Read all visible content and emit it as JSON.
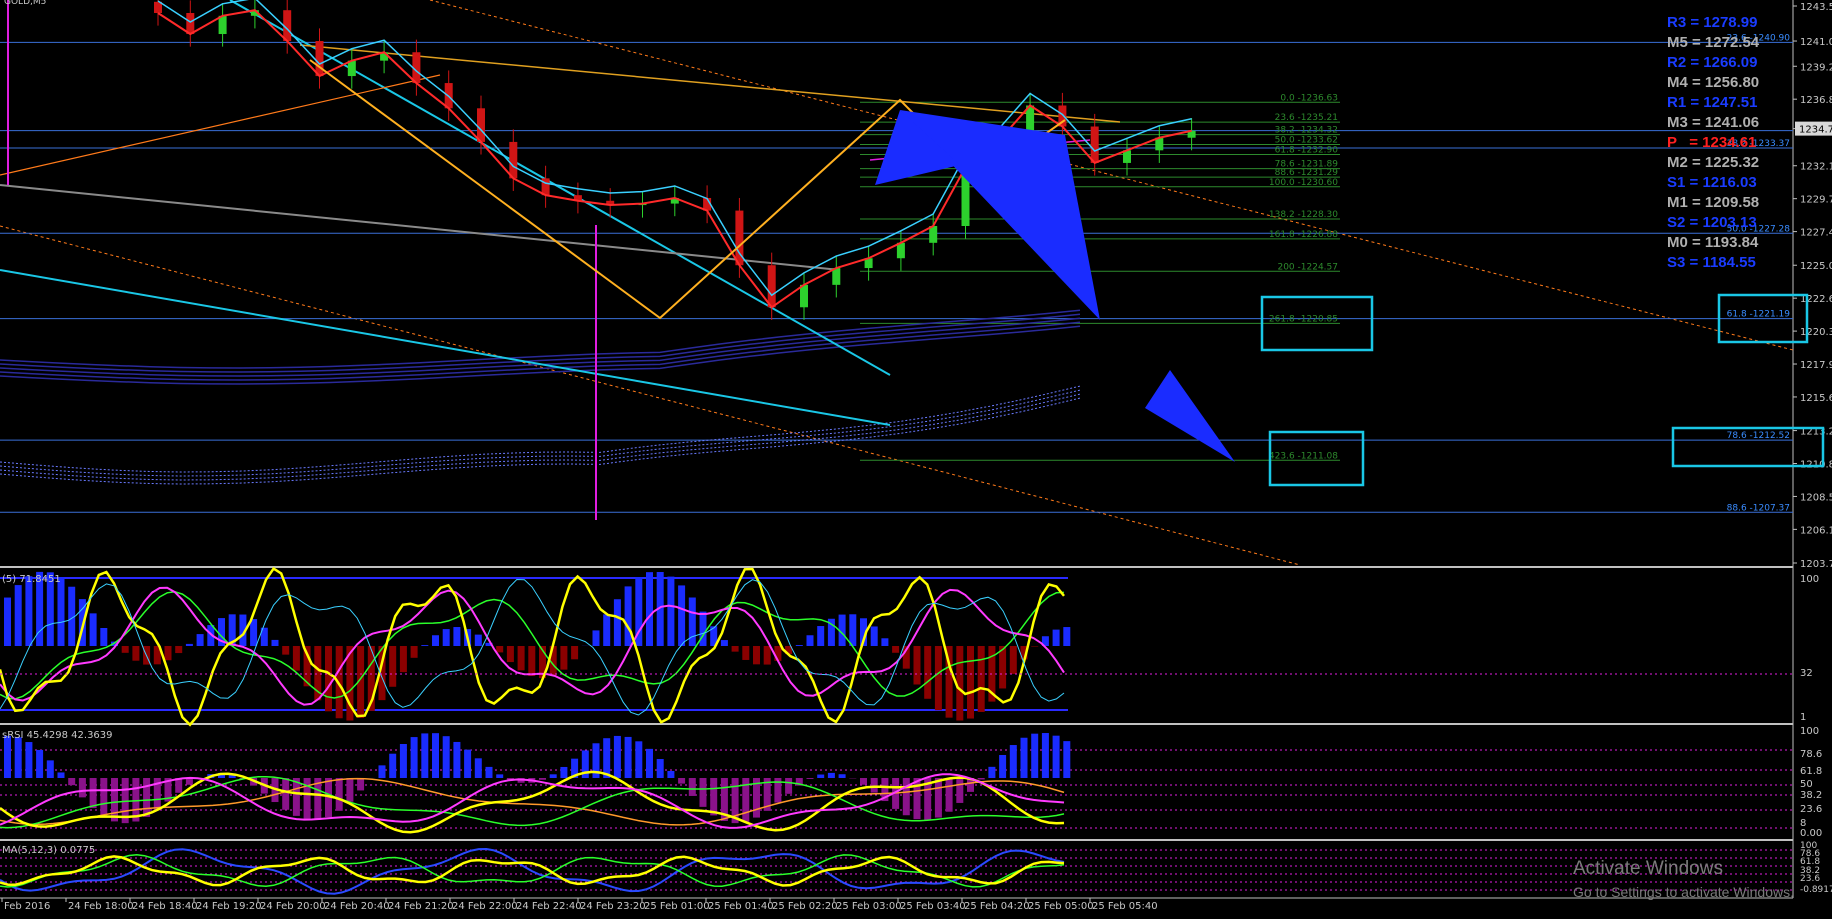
{
  "symbol": "GOLD,M5",
  "colors": {
    "background": "#000000",
    "axis_text": "#c8c8c8",
    "grid_blue": "#3a6fd8",
    "pivot_blue": "#1a3cff",
    "pivot_gray": "#b0b0b0",
    "pivot_red": "#ff2020",
    "fib_green": "#2d8a2d",
    "cyan": "#1ac7e6",
    "orange": "#ff7a1a",
    "magenta": "#e01ee0",
    "yellow": "#ffff00",
    "bull": "#2dd12d",
    "bear": "#d01515",
    "hist_blue": "#1a2cff",
    "hist_dark_red": "#8b0000",
    "hist_purple": "#8a128a"
  },
  "pivots": [
    {
      "label": "R3 = 1278.99",
      "kind": "blue"
    },
    {
      "label": "M5 = 1272.54",
      "kind": "gray"
    },
    {
      "label": "R2 = 1266.09",
      "kind": "blue"
    },
    {
      "label": "M4 = 1256.80",
      "kind": "gray"
    },
    {
      "label": "R1 = 1247.51",
      "kind": "blue"
    },
    {
      "label": "M3 = 1241.06",
      "kind": "gray"
    },
    {
      "label": "P   = 1234.61",
      "kind": "red"
    },
    {
      "label": "M2 = 1225.32",
      "kind": "gray"
    },
    {
      "label": "S1 = 1216.03",
      "kind": "blue"
    },
    {
      "label": "M1 = 1209.58",
      "kind": "gray"
    },
    {
      "label": "S2 = 1203.13",
      "kind": "blue"
    },
    {
      "label": "M0 = 1193.84",
      "kind": "gray"
    },
    {
      "label": "S3 = 1184.55",
      "kind": "blue"
    }
  ],
  "fib_labels_left": [
    {
      "text": "0.0 -1236.63",
      "y": 1236.63
    },
    {
      "text": "23.6 -1235.21",
      "y": 1235.21
    },
    {
      "text": "38.2 -1234.32",
      "y": 1234.32
    },
    {
      "text": "50.0 -1233.62",
      "y": 1233.62
    },
    {
      "text": "61.8 -1232.90",
      "y": 1232.9
    },
    {
      "text": "78.6 -1231.89",
      "y": 1231.89
    },
    {
      "text": "88.6 -1231.29",
      "y": 1231.29
    },
    {
      "text": "100.0 -1230.60",
      "y": 1230.6
    },
    {
      "text": "138.2 -1228.30",
      "y": 1228.3
    },
    {
      "text": "161.8 -1226.88",
      "y": 1226.88
    },
    {
      "text": "200 -1224.57",
      "y": 1224.57
    },
    {
      "text": "261.8 -1220.85",
      "y": 1220.85
    },
    {
      "text": "423.6 -1211.08",
      "y": 1211.08
    }
  ],
  "fib_labels_right": [
    {
      "text": "23.6 -1240.90",
      "y": 1240.9
    },
    {
      "text": "38.2 -1233.37",
      "y": 1233.37
    },
    {
      "text": "50.0 -1227.28",
      "y": 1227.28
    },
    {
      "text": "61.8 -1221.19",
      "y": 1221.19
    },
    {
      "text": "78.6 -1212.52",
      "y": 1212.52
    },
    {
      "text": "88.6 -1207.37",
      "y": 1207.37
    }
  ],
  "horizontal_levels": [
    1240.9,
    1234.61,
    1233.37,
    1227.28,
    1221.19,
    1212.52,
    1207.37
  ],
  "main_axis_ticks": [
    "1243.50",
    "1241.00",
    "1239.20",
    "1236.85",
    "1234.75",
    "1232.10",
    "1229.75",
    "1227.40",
    "1225.00",
    "1222.65",
    "1220.30",
    "1217.95",
    "1215.60",
    "1213.20",
    "1210.85",
    "1208.50",
    "1206.15",
    "1203.75"
  ],
  "current_price": "1234.75",
  "x_labels": [
    "Feb 2016",
    "24 Feb 18:00",
    "24 Feb 18:40",
    "24 Feb 19:20",
    "24 Feb 20:00",
    "24 Feb 20:40",
    "24 Feb 21:20",
    "24 Feb 22:00",
    "24 Feb 22:40",
    "24 Feb 23:20",
    "25 Feb 01:00",
    "25 Feb 01:40",
    "25 Feb 02:20",
    "25 Feb 03:00",
    "25 Feb 03:40",
    "25 Feb 04:20",
    "25 Feb 05:00",
    "25 Feb 05:40"
  ],
  "panel1": {
    "label": "(5) 71.8451",
    "ticks": [
      "100",
      "32",
      "1"
    ]
  },
  "panel2": {
    "label": "sRSI 45.4298 42.3639",
    "ticks": [
      "100",
      "78.6",
      "61.8",
      "50",
      "38.2",
      "23.6",
      "8",
      "0.00"
    ]
  },
  "panel3": {
    "label": "MA(5,12,3) 0.0775",
    "ticks": [
      "100",
      "78.6",
      "61.8",
      "38.2",
      "23.6",
      "-0.8917"
    ]
  },
  "watermark": {
    "title": "Activate Windows",
    "subtitle": "Go to Settings to activate Windows."
  },
  "chart_data": {
    "type": "line",
    "title": "GOLD,M5",
    "xlabel": "",
    "ylabel": "",
    "ylim": [
      1203.75,
      1243.5
    ],
    "x": [
      "24 Feb 17:40",
      "24 Feb 18:00",
      "24 Feb 18:20",
      "24 Feb 18:40",
      "24 Feb 19:00",
      "24 Feb 19:20",
      "24 Feb 19:40",
      "24 Feb 20:00",
      "24 Feb 20:20",
      "24 Feb 20:40",
      "24 Feb 21:00",
      "24 Feb 21:20",
      "24 Feb 21:40",
      "24 Feb 22:00",
      "24 Feb 22:20",
      "24 Feb 22:40",
      "24 Feb 23:00",
      "24 Feb 23:20",
      "25 Feb 00:40",
      "25 Feb 01:00",
      "25 Feb 01:20",
      "25 Feb 01:40",
      "25 Feb 02:00",
      "25 Feb 02:20",
      "25 Feb 02:40",
      "25 Feb 03:00",
      "25 Feb 03:20",
      "25 Feb 03:40",
      "25 Feb 04:00",
      "25 Feb 04:20",
      "25 Feb 04:40",
      "25 Feb 05:00",
      "25 Feb 05:20"
    ],
    "series": [
      {
        "values": [
          1243.0,
          1241.5,
          1242.8,
          1243.2,
          1241.0,
          1238.5,
          1239.6,
          1240.2,
          1238.0,
          1236.2,
          1233.8,
          1231.2,
          1230.0,
          1229.6,
          1229.3,
          1229.4,
          1229.8,
          1228.9,
          1225.0,
          1222.0,
          1223.6,
          1224.8,
          1225.5,
          1226.6,
          1227.8,
          1232.0,
          1233.8,
          1236.4,
          1234.9,
          1232.3,
          1233.2,
          1234.1,
          1234.6
        ]
      }
    ]
  }
}
